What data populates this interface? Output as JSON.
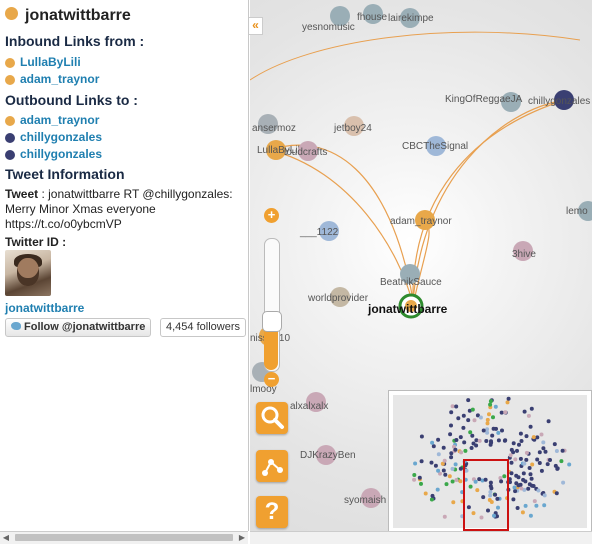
{
  "panel": {
    "title": "jonatwittbarre",
    "inbound_heading": "Inbound Links from :",
    "inbound": [
      {
        "name": "LullaByLili",
        "color": "#e8a84a"
      },
      {
        "name": "adam_traynor",
        "color": "#e8a84a"
      }
    ],
    "outbound_heading": "Outbound Links to :",
    "outbound": [
      {
        "name": "adam_traynor",
        "color": "#e8a84a"
      },
      {
        "name": "chillygonzales",
        "color": "#3a3f72"
      },
      {
        "name": "chillygonzales",
        "color": "#3a3f72"
      }
    ],
    "tweet_heading": "Tweet Information",
    "tweet_label": "Tweet",
    "tweet_text": " : jonatwittbarre RT @chillygonzales: Merry Minor Xmas everyone https://t.co/o0ybcmVP",
    "twitter_id_label": "Twitter ID :",
    "username": "jonatwittbarre",
    "follow_label": "Follow @jonatwittbarre",
    "followers": "4,454 followers"
  },
  "collapse_icon": "«",
  "graph": {
    "focus_node": "jonatwittbarre",
    "nodes": [
      {
        "label": "yesnomusic",
        "color": "#9aaeb6"
      },
      {
        "label": "fhouse",
        "color": "#9aaeb6"
      },
      {
        "label": "lairekimpe",
        "color": "#9aaeb6"
      },
      {
        "label": "KingOfReggaeJA",
        "color": "#9aaeb6"
      },
      {
        "label": "chillygonzales",
        "color": "#3a3f72"
      },
      {
        "label": "ansermoz",
        "color": "#a8b0b6"
      },
      {
        "label": "jetboy24",
        "color": "#d9c0ad"
      },
      {
        "label": "LullaByLili",
        "color": "#e8a84a"
      },
      {
        "label": "loudcrafts",
        "color": "#c9a8b6"
      },
      {
        "label": "CBCTheSignal",
        "color": "#9fb8d8"
      },
      {
        "label": "lemo",
        "color": "#9aaeb6"
      },
      {
        "label": "adam_traynor",
        "color": "#e8a84a"
      },
      {
        "label": "___1122",
        "color": "#9fb8d8"
      },
      {
        "label": "3hive",
        "color": "#c9a8b6"
      },
      {
        "label": "BeatnikSauce",
        "color": "#9aaeb6"
      },
      {
        "label": "worldprovider",
        "color": "#c4b8a4"
      },
      {
        "label": "niss_510",
        "color": "#e8a84a"
      },
      {
        "label": "lmooy",
        "color": "#a8b0b6"
      },
      {
        "label": "alxalxalx",
        "color": "#c9a8b6"
      },
      {
        "label": "DJKrazyBen",
        "color": "#c9a8b6"
      },
      {
        "label": "syomaish",
        "color": "#c9a8b6"
      }
    ]
  },
  "controls": {
    "zoom_in": "+",
    "zoom_out": "−",
    "zoom_level": 0.3,
    "search_icon": "magnifier-icon",
    "layout_icon": "network-icon",
    "help_icon": "question-icon",
    "help_glyph": "?"
  }
}
